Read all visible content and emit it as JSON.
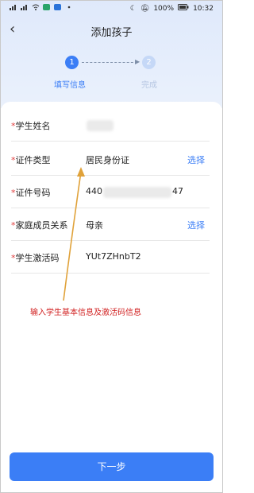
{
  "status_bar": {
    "battery": "100%",
    "time": "10:32"
  },
  "header": {
    "title": "添加孩子"
  },
  "steps": [
    {
      "number": "1",
      "label": "填写信息"
    },
    {
      "number": "2",
      "label": "完成"
    }
  ],
  "form": {
    "rows": [
      {
        "label": "学生姓名",
        "value": "",
        "action": ""
      },
      {
        "label": "证件类型",
        "value": "居民身份证",
        "action": "选择"
      },
      {
        "label": "证件号码",
        "value_prefix": "440",
        "value_suffix": "47",
        "action": ""
      },
      {
        "label": "家庭成员关系",
        "value": "母亲",
        "action": "选择"
      },
      {
        "label": "学生激活码",
        "value": "YUt7ZHnbT2",
        "action": ""
      }
    ]
  },
  "annotation": "输入学生基本信息及激活码信息",
  "footer": {
    "next_label": "下一步"
  },
  "colors": {
    "accent": "#3b7ef6",
    "annotation": "#d12020"
  }
}
